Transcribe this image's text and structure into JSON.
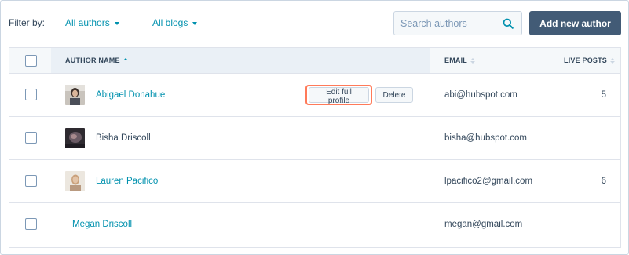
{
  "filter": {
    "label": "Filter by:",
    "authors_dropdown": "All authors",
    "blogs_dropdown": "All blogs"
  },
  "search": {
    "placeholder": "Search authors",
    "icon": "search-icon"
  },
  "actions": {
    "add_label": "Add new author"
  },
  "table": {
    "headers": {
      "author": "AUTHOR NAME",
      "email": "EMAIL",
      "posts": "LIVE POSTS"
    },
    "rows": [
      {
        "name": "Abigael Donahue",
        "email": "abi@hubspot.com",
        "posts": "5",
        "has_avatar": true,
        "name_style": "link"
      },
      {
        "name": "Bisha Driscoll",
        "email": "bisha@hubspot.com",
        "posts": "",
        "has_avatar": true,
        "name_style": "plain"
      },
      {
        "name": "Lauren Pacifico",
        "email": "lpacifico2@gmail.com",
        "posts": "6",
        "has_avatar": true,
        "name_style": "link"
      },
      {
        "name": "Megan Driscoll",
        "email": "megan@gmail.com",
        "posts": "",
        "has_avatar": false,
        "name_style": "link"
      }
    ],
    "row_actions": {
      "edit_label": "Edit full profile",
      "delete_label": "Delete"
    }
  },
  "colors": {
    "link": "#0091ae",
    "primary_button": "#425b76",
    "highlight": "#ff7a59",
    "text": "#33475b"
  }
}
